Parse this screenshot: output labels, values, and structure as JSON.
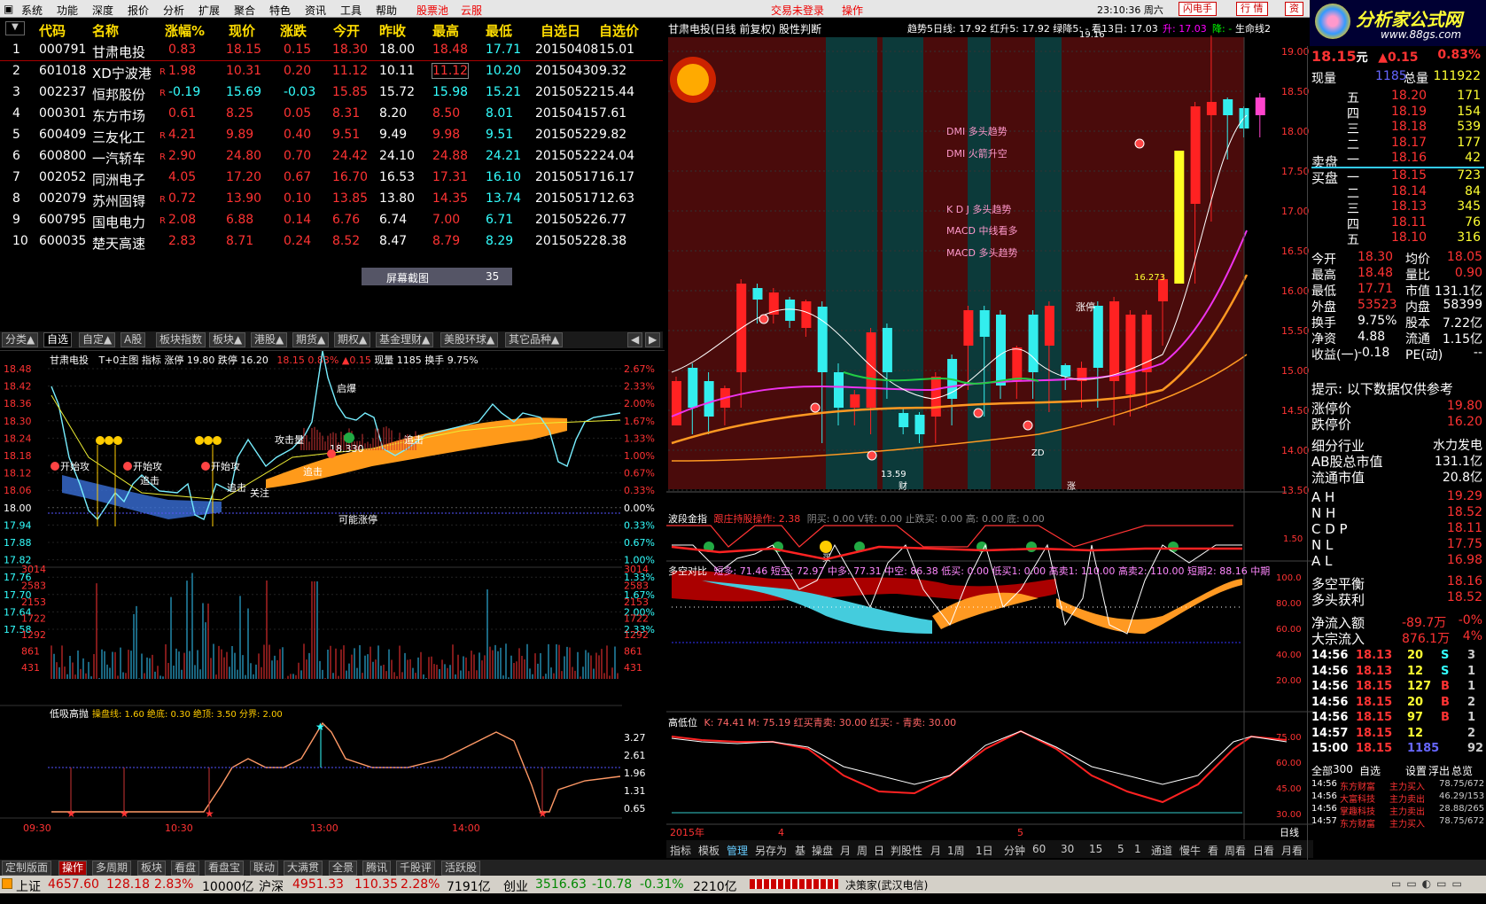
{
  "menu": {
    "items": [
      "系统",
      "功能",
      "深度",
      "报价",
      "分析",
      "扩展",
      "聚合",
      "特色",
      "资讯",
      "工具",
      "帮助"
    ],
    "stockpool": "股票池",
    "cloud": "云服",
    "login": "交易未登录",
    "operate": "操作",
    "time": "23:10:36 周六",
    "flash": "闪电手",
    "quote": "行 情",
    "asset": "资"
  },
  "logo": {
    "text": "分析家公式网",
    "url": "www.88gs.com"
  },
  "watchlist": {
    "headers": [
      "代码",
      "名称",
      "涨幅%",
      "现价",
      "涨跌",
      "今开",
      "昨收",
      "最高",
      "最低",
      "自选日",
      "自选价"
    ],
    "rows": [
      [
        "1",
        "000791",
        "甘肃电投",
        "",
        "0.83",
        "18.15",
        "0.15",
        "18.30",
        "18.00",
        "18.48",
        "17.71",
        "20150408",
        "15.01"
      ],
      [
        "2",
        "601018",
        "XD宁波港",
        "R",
        "1.98",
        "10.31",
        "0.20",
        "11.12",
        "10.11",
        "11.12",
        "10.20",
        "20150430",
        "9.32"
      ],
      [
        "3",
        "002237",
        "恒邦股份",
        "R",
        "-0.19",
        "15.69",
        "-0.03",
        "15.85",
        "15.72",
        "15.98",
        "15.21",
        "20150522",
        "15.44"
      ],
      [
        "4",
        "000301",
        "东方市场",
        "",
        "0.61",
        "8.25",
        "0.05",
        "8.31",
        "8.20",
        "8.50",
        "8.01",
        "20150415",
        "7.61"
      ],
      [
        "5",
        "600409",
        "三友化工",
        "R",
        "4.21",
        "9.89",
        "0.40",
        "9.51",
        "9.49",
        "9.98",
        "9.51",
        "20150522",
        "9.82"
      ],
      [
        "6",
        "600800",
        "一汽轿车",
        "R",
        "2.90",
        "24.80",
        "0.70",
        "24.42",
        "24.10",
        "24.88",
        "24.21",
        "20150522",
        "24.04"
      ],
      [
        "7",
        "002052",
        "同洲电子",
        "",
        "4.05",
        "17.20",
        "0.67",
        "16.70",
        "16.53",
        "17.31",
        "16.10",
        "20150517",
        "16.17"
      ],
      [
        "8",
        "002079",
        "苏州固锝",
        "R",
        "0.72",
        "13.90",
        "0.10",
        "13.85",
        "13.80",
        "14.35",
        "13.74",
        "20150517",
        "12.63"
      ],
      [
        "9",
        "600795",
        "国电电力",
        "R",
        "2.08",
        "6.88",
        "0.14",
        "6.76",
        "6.74",
        "7.00",
        "6.71",
        "20150522",
        "6.77"
      ],
      [
        "10",
        "600035",
        "楚天高速",
        "",
        "2.83",
        "8.71",
        "0.24",
        "8.52",
        "8.47",
        "8.79",
        "8.29",
        "20150522",
        "8.38"
      ]
    ],
    "screenshot_label": "屏幕截图",
    "screenshot_count": "35"
  },
  "tabs": [
    "分类▲",
    "自选",
    "自定▲",
    "A股",
    "板块指数",
    "板块▲",
    "港股▲",
    "期货▲",
    "期权▲",
    "基金理财▲",
    "美股环球▲",
    "其它品种▲"
  ],
  "intraday": {
    "title": "甘肃电投",
    "subtitle": "T+0主图 指标 涨停 19.80 跌停 16.20",
    "price": "18.15",
    "pct": "0.83%",
    "chg": "▲0.15",
    "vol": "现量 1185",
    "turnover": "换手 9.75%",
    "yticks": [
      "18.48",
      "18.42",
      "18.36",
      "18.30",
      "18.24",
      "18.18",
      "18.12",
      "18.06",
      "18.00",
      "17.94",
      "17.88",
      "17.82",
      "17.76",
      "17.70",
      "17.64",
      "17.58"
    ],
    "pticks": [
      "2.67%",
      "2.33%",
      "2.00%",
      "1.67%",
      "1.33%",
      "1.00%",
      "0.67%",
      "0.33%",
      "0.00%",
      "0.33%",
      "0.67%",
      "1.00%",
      "1.33%",
      "1.67%",
      "2.00%",
      "2.33%"
    ],
    "vticks": [
      "3014",
      "2583",
      "2153",
      "1722",
      "1292",
      "861",
      "431"
    ],
    "labels": [
      "开始攻",
      "开始攻",
      "开始攻",
      "追击",
      "追击",
      "追击",
      "追击",
      "攻击量",
      "启爆",
      "关注",
      "可能涨停",
      "18.330"
    ],
    "sub_title": "低吸高抛",
    "sub_params": "操盘线: 1.60  绝底: 0.30  绝顶: 3.50  分界: 2.00",
    "sub_ticks": [
      "3.27",
      "2.61",
      "1.96",
      "1.31",
      "0.65"
    ],
    "times": [
      "09:30",
      "10:30",
      "13:00",
      "14:00"
    ]
  },
  "kline": {
    "title": "甘肃电投(日线 前复权) 股性判断",
    "info": "趋势5日线: 17.92  红升5: 17.92  绿降5: -  看13日: 17.03",
    "rise": "升: 17.03",
    "fall": "降: -",
    "life": "生命线2",
    "yticks": [
      "19.00",
      "18.50",
      "18.00",
      "17.50",
      "17.00",
      "16.50",
      "16.00",
      "15.50",
      "15.00",
      "14.50",
      "14.00",
      "13.50"
    ],
    "notes": [
      "DMI 多头趋势",
      "DMI 火箭升空",
      "K D J 多头趋势",
      "MACD 中线看多",
      "MACD 多头趋势"
    ],
    "hi": "19.16",
    "lo": "13.59",
    "ma": "16.273",
    "zt": "涨停",
    "zd": "ZD",
    "cai": "财",
    "zhang": "涨"
  },
  "ind1": {
    "title": "波段金指",
    "param": "跟庄持股操作: 2.38",
    "others": "阴买: 0.00  V转: 0.00  止跌买: 0.00  高: 0.00  底: 0.00",
    "tick": "1.50",
    "buy": "买"
  },
  "ind2": {
    "title": "多空对比",
    "params": "短多: 71.46  短空: 72.97  中多: 77.31  中空: 86.38  低买: 0.00  低买1: 0.00  高卖1: 110.00  高卖2: 110.00  短期2: 88.16  中期",
    "ticks": [
      "100.0",
      "80.00",
      "60.00",
      "40.00",
      "20.00"
    ]
  },
  "ind3": {
    "title": "高低位",
    "params": "K: 74.41  M: 75.19  红买青卖: 30.00  红买: -  青卖: 30.00",
    "ticks": [
      "75.00",
      "60.00",
      "45.00",
      "30.00"
    ]
  },
  "dates": [
    "2015年",
    "4",
    "5"
  ],
  "period": "日线",
  "toolbar": [
    "指标",
    "模板",
    "管理",
    "另存为",
    "基",
    "操盘",
    "月",
    "周",
    "日",
    "判股性",
    "月",
    "1周",
    "1日",
    "分钟",
    "60",
    "30",
    "15",
    "5",
    "1",
    "通道",
    "慢牛",
    "看",
    "周看",
    "日看",
    "月看"
  ],
  "quote": {
    "price": "18.15",
    "unit": "元",
    "chg": "▲0.15",
    "pct": "0.83%",
    "now_label": "现量",
    "now": "1185",
    "total_label": "总量",
    "total": "111922",
    "asks": [
      [
        "五",
        "18.20",
        "171"
      ],
      [
        "四",
        "18.19",
        "154"
      ],
      [
        "三",
        "18.18",
        "539"
      ],
      [
        "二",
        "18.17",
        "177"
      ],
      [
        "一",
        "18.16",
        "42"
      ]
    ],
    "bids": [
      [
        "一",
        "18.15",
        "723"
      ],
      [
        "二",
        "18.14",
        "84"
      ],
      [
        "三",
        "18.13",
        "345"
      ],
      [
        "四",
        "18.11",
        "76"
      ],
      [
        "五",
        "18.10",
        "316"
      ]
    ],
    "sell_label": "卖盘",
    "buy_label": "买盘",
    "stats": [
      [
        "今开",
        "18.30",
        "均价",
        "18.05"
      ],
      [
        "最高",
        "18.48",
        "量比",
        "0.90"
      ],
      [
        "最低",
        "17.71",
        "市值",
        "131.1亿"
      ],
      [
        "外盘",
        "53523",
        "内盘",
        "58399"
      ],
      [
        "换手",
        "9.75%",
        "股本",
        "7.22亿"
      ],
      [
        "净资",
        "4.88",
        "流通",
        "1.15亿"
      ],
      [
        "收益(一)",
        "-0.18",
        "PE(动)",
        "--"
      ]
    ],
    "tip": "提示: 以下数据仅供参考",
    "limits": [
      [
        "涨停价",
        "19.80"
      ],
      [
        "跌停价",
        "16.20"
      ]
    ],
    "industry": [
      [
        "细分行业",
        "水力发电"
      ],
      [
        "AB股总市值",
        "131.1亿"
      ],
      [
        "流通市值",
        "20.8亿"
      ]
    ],
    "ah": [
      [
        "A H",
        "19.29"
      ],
      [
        "N H",
        "18.52"
      ],
      [
        "C D P",
        "18.11"
      ],
      [
        "N L",
        "17.75"
      ],
      [
        "A L",
        "16.98"
      ]
    ],
    "balance": [
      [
        "多空平衡",
        "18.16"
      ],
      [
        "多头获利",
        "18.52"
      ]
    ],
    "flow": [
      [
        "净流入额",
        "-89.7万",
        "-0%"
      ],
      [
        "大宗流入",
        "876.1万",
        "4%"
      ]
    ],
    "ticks": [
      [
        "14:56",
        "18.13",
        "20",
        "S",
        "3"
      ],
      [
        "14:56",
        "18.13",
        "12",
        "S",
        "1"
      ],
      [
        "14:56",
        "18.15",
        "127",
        "B",
        "1"
      ],
      [
        "14:56",
        "18.15",
        "20",
        "B",
        "2"
      ],
      [
        "14:56",
        "18.15",
        "97",
        "B",
        "1"
      ],
      [
        "14:57",
        "18.15",
        "12",
        "",
        "2"
      ],
      [
        "15:00",
        "18.15",
        "1185",
        "",
        "92"
      ]
    ],
    "tick_tabs": [
      "全部",
      "300",
      "自选",
      "设置",
      "浮出",
      "总览"
    ],
    "news": [
      [
        "14:56",
        "东方财富",
        "主力买入",
        "78.75/672"
      ],
      [
        "14:56",
        "大富科技",
        "主力卖出",
        "46.29/153"
      ],
      [
        "14:56",
        "掌趣科技",
        "主力卖出",
        "28.88/265"
      ],
      [
        "14:57",
        "东方财富",
        "主力买入",
        "78.75/672"
      ]
    ]
  },
  "bottomtabs": [
    "定制版面",
    "操作",
    "多周期",
    "板块",
    "看盘",
    "看盘宝",
    "联动",
    "大满贯",
    "全景",
    "腾讯",
    "千股评",
    "活跃股"
  ],
  "status": {
    "sh_label": "上证",
    "sh": "4657.60",
    "sh_chg": "128.18",
    "sh_pct": "2.83%",
    "sh_amt": "10000亿",
    "sz_label": "沪深",
    "sz": "4951.33",
    "sz_chg": "110.35",
    "sz_pct": "2.28%",
    "sz_amt": "7191亿",
    "cy_label": "创业",
    "cy": "3516.63",
    "cy_chg": "-10.78",
    "cy_pct": "-0.31%",
    "cy_amt": "2210亿",
    "broker": "决策家(武汉电信)"
  }
}
